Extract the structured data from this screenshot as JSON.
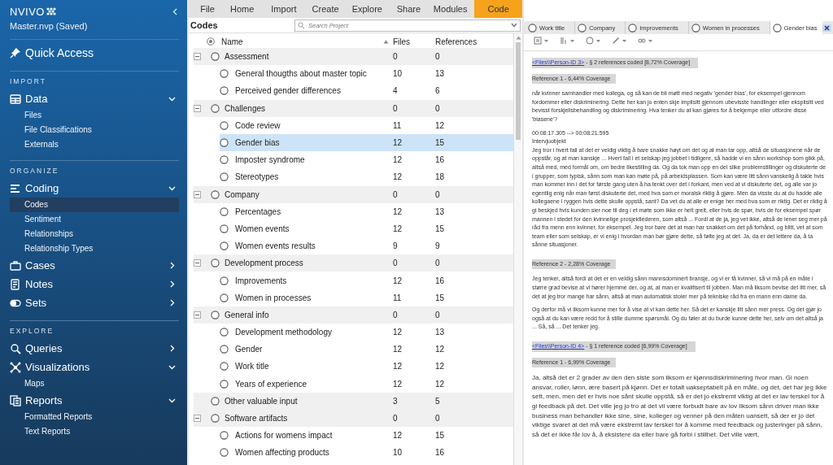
{
  "sidebar": {
    "logo": "NVIVO",
    "project": "Master.nvp (Saved)",
    "quick_access": "Quick Access",
    "groups": [
      {
        "heading": "IMPORT",
        "items": [
          {
            "label": "Data",
            "expanded": true,
            "children": [
              {
                "label": "Files",
                "selected": false
              },
              {
                "label": "File Classifications",
                "selected": false
              },
              {
                "label": "Externals",
                "selected": false
              }
            ]
          }
        ]
      },
      {
        "heading": "ORGANIZE",
        "items": [
          {
            "label": "Coding",
            "expanded": true,
            "children": [
              {
                "label": "Codes",
                "selected": true
              },
              {
                "label": "Sentiment",
                "selected": false
              },
              {
                "label": "Relationships",
                "selected": false
              },
              {
                "label": "Relationship Types",
                "selected": false
              }
            ]
          },
          {
            "label": "Cases",
            "expanded": false
          },
          {
            "label": "Notes",
            "expanded": false
          },
          {
            "label": "Sets",
            "expanded": false
          }
        ]
      },
      {
        "heading": "EXPLORE",
        "items": [
          {
            "label": "Queries",
            "expanded": false
          },
          {
            "label": "Visualizations",
            "expanded": true,
            "children": [
              {
                "label": "Maps",
                "selected": false
              }
            ]
          },
          {
            "label": "Reports",
            "expanded": true,
            "children": [
              {
                "label": "Formatted Reports",
                "selected": false
              },
              {
                "label": "Text Reports",
                "selected": false
              }
            ]
          }
        ]
      }
    ]
  },
  "ribbon_tabs": [
    {
      "label": "File",
      "selected": false
    },
    {
      "label": "Home",
      "selected": false
    },
    {
      "label": "Import",
      "selected": false
    },
    {
      "label": "Create",
      "selected": false
    },
    {
      "label": "Explore",
      "selected": false
    },
    {
      "label": "Share",
      "selected": false
    },
    {
      "label": "Modules",
      "selected": false
    },
    {
      "label": "Code",
      "selected": true
    }
  ],
  "codes": {
    "title": "Codes",
    "search": {
      "placeholder": "Search Project"
    },
    "columns": [
      "Name",
      "Files",
      "References"
    ],
    "rows": [
      {
        "name": "Assessment",
        "files": "0",
        "references": "0",
        "selected": false,
        "expanded": true,
        "children": [
          {
            "name": "General thougths about master topic",
            "files": "10",
            "references": "13",
            "selected": false
          },
          {
            "name": "Perceived gender differences",
            "files": "4",
            "references": "6",
            "selected": false
          }
        ]
      },
      {
        "name": "Challenges",
        "files": "0",
        "references": "0",
        "selected": false,
        "expanded": true,
        "children": [
          {
            "name": "Code review",
            "files": "11",
            "references": "12",
            "selected": false
          },
          {
            "name": "Gender bias",
            "files": "12",
            "references": "15",
            "selected": true
          },
          {
            "name": "Imposter syndrome",
            "files": "12",
            "references": "16",
            "selected": false
          },
          {
            "name": "Stereotypes",
            "files": "12",
            "references": "18",
            "selected": false
          }
        ]
      },
      {
        "name": "Company",
        "files": "0",
        "references": "0",
        "selected": false,
        "expanded": true,
        "children": [
          {
            "name": "Percentages",
            "files": "12",
            "references": "13",
            "selected": false
          },
          {
            "name": "Women events",
            "files": "12",
            "references": "15",
            "selected": false
          },
          {
            "name": "Women events results",
            "files": "9",
            "references": "9",
            "selected": false
          }
        ]
      },
      {
        "name": "Development process",
        "files": "0",
        "references": "0",
        "selected": false,
        "expanded": true,
        "children": [
          {
            "name": "Improvements",
            "files": "12",
            "references": "16",
            "selected": false
          },
          {
            "name": "Women in processes",
            "files": "11",
            "references": "15",
            "selected": false
          }
        ]
      },
      {
        "name": "General info",
        "files": "0",
        "references": "0",
        "selected": false,
        "expanded": true,
        "children": [
          {
            "name": "Development methodology",
            "files": "12",
            "references": "13",
            "selected": false
          },
          {
            "name": "Gender",
            "files": "12",
            "references": "12",
            "selected": false
          },
          {
            "name": "Work title",
            "files": "12",
            "references": "12",
            "selected": false
          },
          {
            "name": "Years of experience",
            "files": "12",
            "references": "12",
            "selected": false
          }
        ]
      },
      {
        "name": "Other valuable input",
        "files": "3",
        "references": "5",
        "selected": false
      },
      {
        "name": "Software artifacts",
        "files": "0",
        "references": "0",
        "selected": false,
        "expanded": true,
        "children": [
          {
            "name": "Actions for womens impact",
            "files": "12",
            "references": "15",
            "selected": false
          },
          {
            "name": "Women affecting products",
            "files": "10",
            "references": "16",
            "selected": false
          }
        ]
      }
    ]
  },
  "detail": {
    "tabs": [
      {
        "label": "Work title",
        "selected": false
      },
      {
        "label": "Company",
        "selected": false
      },
      {
        "label": "Improvements",
        "selected": false
      },
      {
        "label": "Women in processes",
        "selected": false
      },
      {
        "label": "Gender bias",
        "selected": true
      }
    ],
    "blocks": [
      {
        "kind": "source",
        "link": "<Files\\\\Person-ID 3>",
        "text": " - § 2 references coded  [8,72% Coverage]"
      },
      {
        "kind": "reference",
        "text": "Reference 1 - 6,44% Coverage"
      },
      {
        "kind": "paragraph",
        "text": "når kvinner samhandler med kollega, og så kan de bli møtt med negativ 'gender bias', for eksempel gjennom fordommer eller diskriminering. Dette her kan jo enten skje implisitt gjennom ubevisste handlinger eller eksplisitt ved bevisst forskjellsbehandling og diskriminering. Hva tenker du at kan gjøres for å bekjempe eller utfordre disse 'biasene'?"
      },
      {
        "kind": "line",
        "text": "00:08:17.305 --> 00:08:21.595"
      },
      {
        "kind": "line",
        "text": "Intervjuobjekt"
      },
      {
        "kind": "line",
        "text": "Jeg tror i hvert fall at det er veldig viktig å bare snakke høyt om det og at man tar opp, altså de situasjonene når de oppstår, og at man kanskje ... Hvert fall i et selskap jeg jobbet i tidligere, så hadde vi en sånn workshop som gikk på, altså med, med formål om, om bedre likestilling da. Og da tok man opp en del slike problemstillinger og diskuterte de i grupper, som typisk, sånn som man kan møte på, på arbeidsplassen. Som kan være litt sånn vanskelig å takle hvis man kommer inn i det for første gang uten å ha tenkt over det i forkant, men ved at vi diskuterte det, og alle var jo egentlig enig når man først diskuterte det, med hva som er moralsk riktig å gjøre. Men da visste du at du hadde alle kollegaene i ryggen hvis dette skulle oppstå, sant? Da vet du at alle er enige her med hva som er riktig. Det er riktig å gi beskjed hvis kunden sier noe til deg i et møte som ikke er helt greit, eller hvis de spør, hvis de for eksempel spør mannen i stedet for den kvinnelige prosjektlederen, som altså ... Fordi at de ja, jeg vet ikke, altså de lener seg mer på råd fra menn enn kvinner, for eksempel. Jeg tror bare det at man har snakket om det på forhånd, og blitt, vet at som team eller som selskap, er vi enig i hvordan man bør gjøre dette, så følte jeg at det. Ja, da er det lettere da, å ta sånne situasjoner."
      },
      {
        "kind": "reference",
        "text": "Reference 2 - 2,28% Coverage"
      },
      {
        "kind": "paragraph",
        "text": "Jeg tenker, altså fordi at det er en veldig sånn mannsdominert bransje, og vi er få kvinner, så vi må på en måte i større grad bevise at vi hører hjemme der, og at, at man er kvalifisert til jobben. Man må liksom bevise det litt mer, så det at jeg tror mange har sånn, altså at man automatisk stoler mer på tekniske råd fra en mann enn dame da."
      },
      {
        "kind": "line",
        "text": "Og derfor må vi liksom kunne mer for å vise at vi kan dette her. Så det er kanskje litt sånn mer press. Og det gjør jo også at du kan være redd for å stille dumme spørsmål. Og du føler at du burde kunne dette her, selv om det altså ja ... Så, så ... Det tenker jeg."
      },
      {
        "kind": "source",
        "link": "<Files\\\\Person-ID 4>",
        "text": " - § 1 reference coded  [6,99% Coverage]"
      },
      {
        "kind": "reference",
        "text": "Reference 1 - 6,99% Coverage"
      },
      {
        "kind": "large",
        "text": "Ja, altså det er 2 grader av den den siste som liksom er kjønnsdiskriminering hvor man. Gi noen ansvar, roller, lønn, ære basert på kjønn. Det er totalt uakseptabelt på en måte, og det, det har jeg ikke sett, men, men det er hvis noe sånt skulle oppstå, så er det jo ekstremt viktig at det er lav terskel for å gi feedback på det. Det ville jeg jo tro at det vil være forbudt bare av lov liksom sånn driver man ikke business man behandler ikke sine, sine, kolleger og venner på den måten uansett, så der er jo det viktige svaret at det må være ekstremt lav terskel for å komme med feedback og justeringer på sånn, så det er ikke får lov å, å eksistere da eller bare gå forbi i stillhet. Det ville vært,"
      }
    ]
  }
}
